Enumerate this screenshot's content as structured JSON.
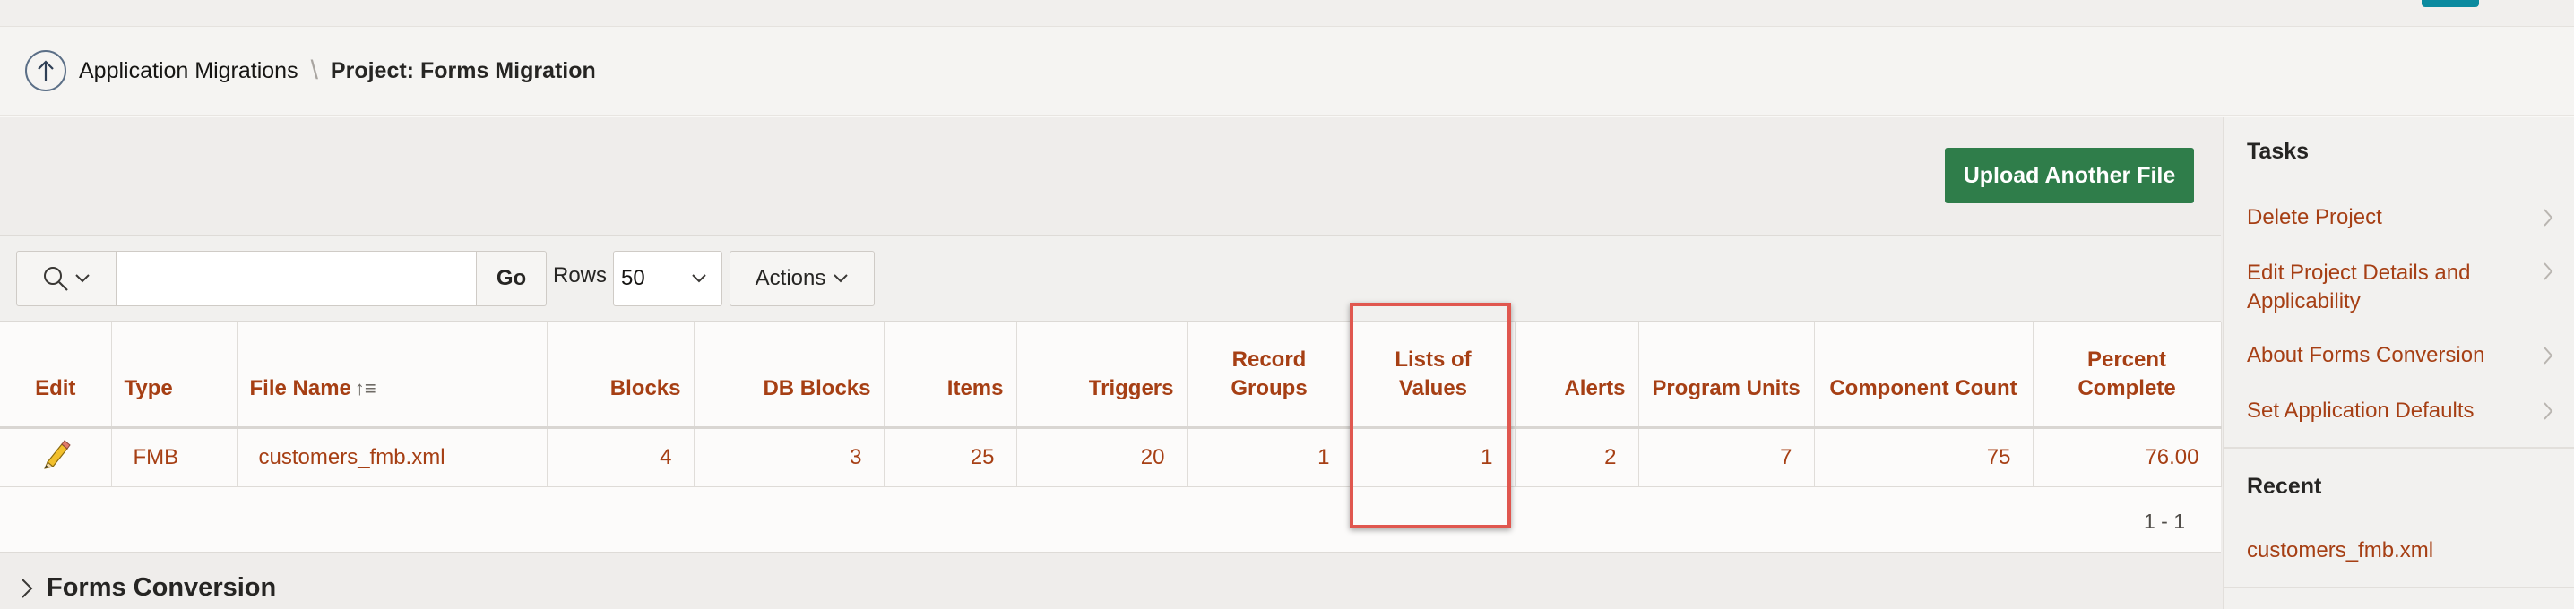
{
  "breadcrumb": {
    "parent": "Application Migrations",
    "current": "Project: Forms Migration"
  },
  "upload_button": "Upload Another File",
  "toolbar": {
    "go": "Go",
    "rows_label": "Rows",
    "rows_value": "50",
    "actions": "Actions",
    "search_placeholder": ""
  },
  "table": {
    "headers": [
      "Edit",
      "Type",
      "File Name",
      "Blocks",
      "DB Blocks",
      "Items",
      "Triggers",
      "Record Groups",
      "Lists of Values",
      "Alerts",
      "Program Units",
      "Component Count",
      "Percent Complete"
    ],
    "row": {
      "type": "FMB",
      "file_name": "customers_fmb.xml",
      "blocks": "4",
      "db_blocks": "3",
      "items": "25",
      "triggers": "20",
      "record_groups": "1",
      "lists_of_values": "1",
      "alerts": "2",
      "program_units": "7",
      "component_count": "75",
      "percent_complete": "76.00"
    },
    "pagination": "1 - 1"
  },
  "region_title": "Forms Conversion",
  "sidebar": {
    "tasks_title": "Tasks",
    "tasks": [
      "Delete Project",
      "Edit Project Details and Applicability",
      "About Forms Conversion",
      "Set Application Defaults"
    ],
    "recent_title": "Recent",
    "recent": [
      "customers_fmb.xml"
    ]
  },
  "colors": {
    "link": "#a63f14",
    "upload_button": "#2f7d4a",
    "highlight": "#e0574f"
  }
}
